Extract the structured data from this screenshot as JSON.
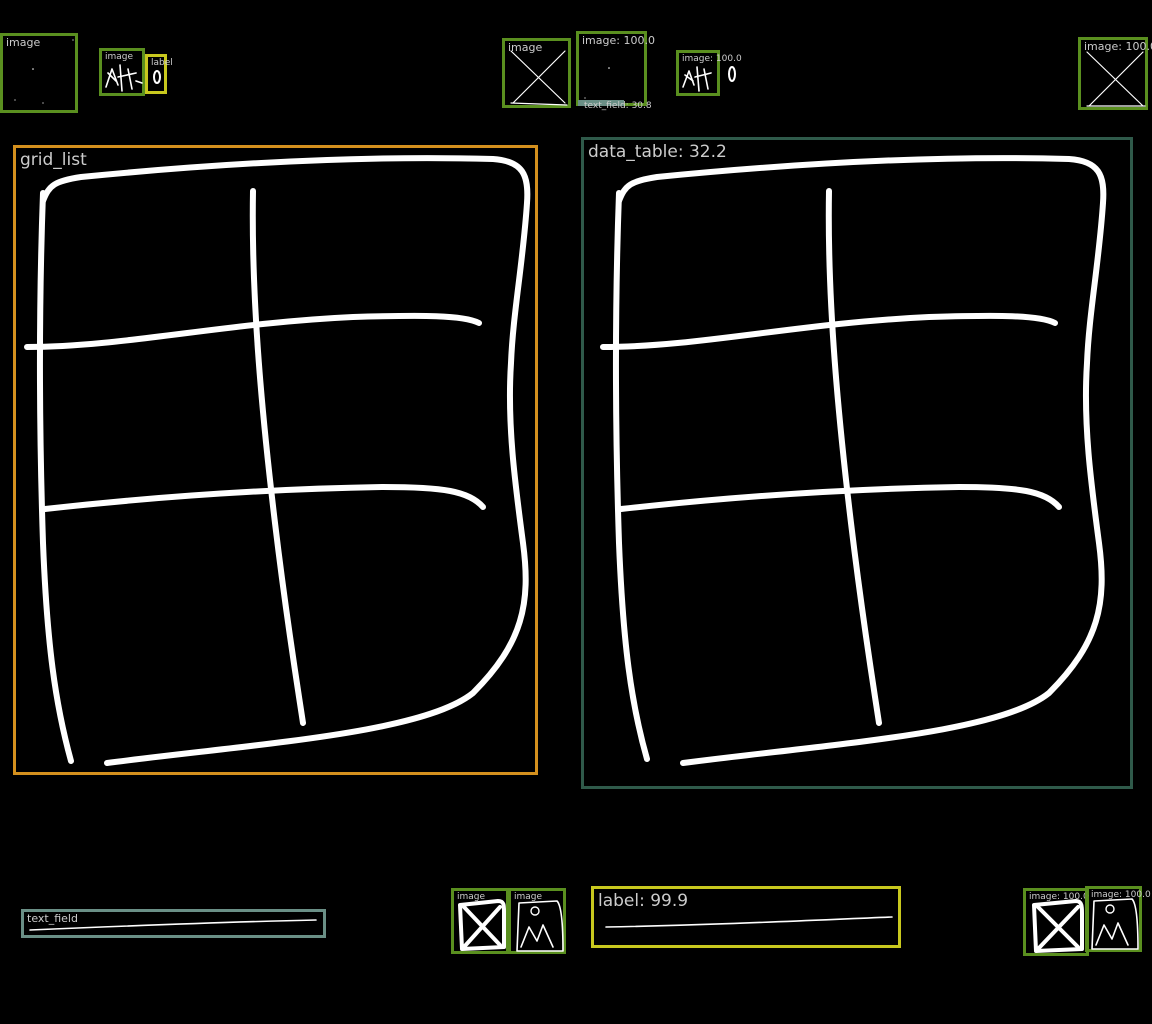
{
  "detections": {
    "top_image_1": "image",
    "top_image_2": "image",
    "top_label_1": "label",
    "top_image_3": "image",
    "top_image_4": "image: 100.0",
    "top_text_field": "text_field: 30.8",
    "top_image_5": "image: 100.0",
    "top_image_6": "image: 100.0",
    "grid_list": "grid_list",
    "data_table": "data_table: 32.2",
    "bottom_text_field": "text_field",
    "bottom_image_1": "image",
    "bottom_image_2": "image",
    "bottom_label": "label: 99.9",
    "bottom_image_3": "image: 100.0",
    "bottom_image_4": "image: 100.0"
  },
  "colors": {
    "background": "#000000",
    "image_box": "#5a8f1f",
    "label_box": "#c8c81e",
    "grid_list_box": "#d4901e",
    "data_table_box": "#2f5a4a",
    "text_field_box": "#6a8f86",
    "sketch_stroke": "#ffffff"
  }
}
